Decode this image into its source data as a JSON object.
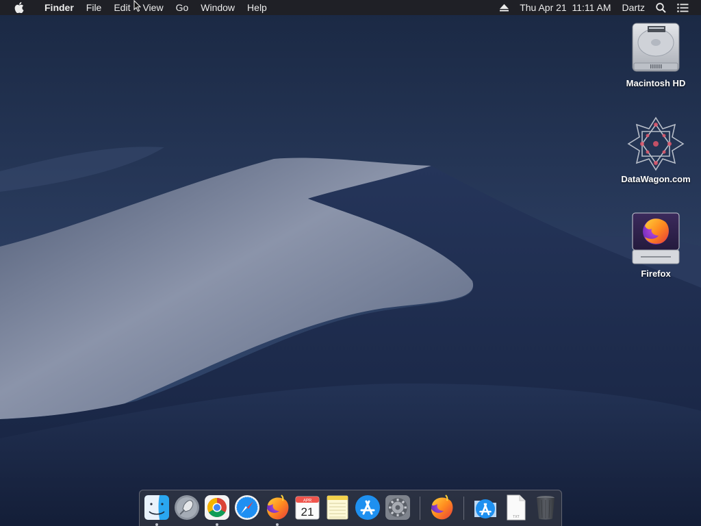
{
  "menubar": {
    "apple_icon": "apple-logo-icon",
    "app_name": "Finder",
    "menus": [
      "File",
      "Edit",
      "View",
      "Go",
      "Window",
      "Help"
    ],
    "eject_icon": "eject-icon",
    "datetime": "Thu Apr 21  11:11 AM",
    "user": "Dartz",
    "spotlight_icon": "magnifier-icon",
    "notification_icon": "list-icon"
  },
  "desktop_icons": [
    {
      "label": "Macintosh HD",
      "icon": "hard-drive-icon"
    },
    {
      "label": "DataWagon.com",
      "icon": "disk-image-icon"
    },
    {
      "label": "Firefox",
      "icon": "firefox-volume-icon"
    }
  ],
  "dock": {
    "items": [
      {
        "name": "Finder",
        "icon": "finder-icon",
        "running": true
      },
      {
        "name": "Launchpad",
        "icon": "launchpad-icon",
        "running": false
      },
      {
        "name": "Google Chrome",
        "icon": "chrome-icon",
        "running": true
      },
      {
        "name": "Safari",
        "icon": "safari-icon",
        "running": false
      },
      {
        "name": "Firefox",
        "icon": "firefox-icon",
        "running": true
      },
      {
        "name": "Calendar",
        "icon": "calendar-icon",
        "running": false,
        "month": "APR",
        "day": "21"
      },
      {
        "name": "Notes",
        "icon": "notes-icon",
        "running": false
      },
      {
        "name": "App Store",
        "icon": "app-store-icon",
        "running": false
      },
      {
        "name": "System Preferences",
        "icon": "gear-icon",
        "running": false
      },
      {
        "name": "Firefox",
        "icon": "firefox-icon",
        "running": false
      },
      {
        "name": "Applications",
        "icon": "app-store-folder-icon",
        "running": false
      },
      {
        "name": "Document",
        "icon": "text-file-icon",
        "running": false,
        "badge": "TXT"
      },
      {
        "name": "Trash",
        "icon": "trash-icon",
        "running": false
      }
    ]
  },
  "colors": {
    "menubar_bg": "#202024",
    "sky_top": "#1b2a44",
    "dune_light": "#8a93a8",
    "dune_dark": "#1e2b4a"
  }
}
